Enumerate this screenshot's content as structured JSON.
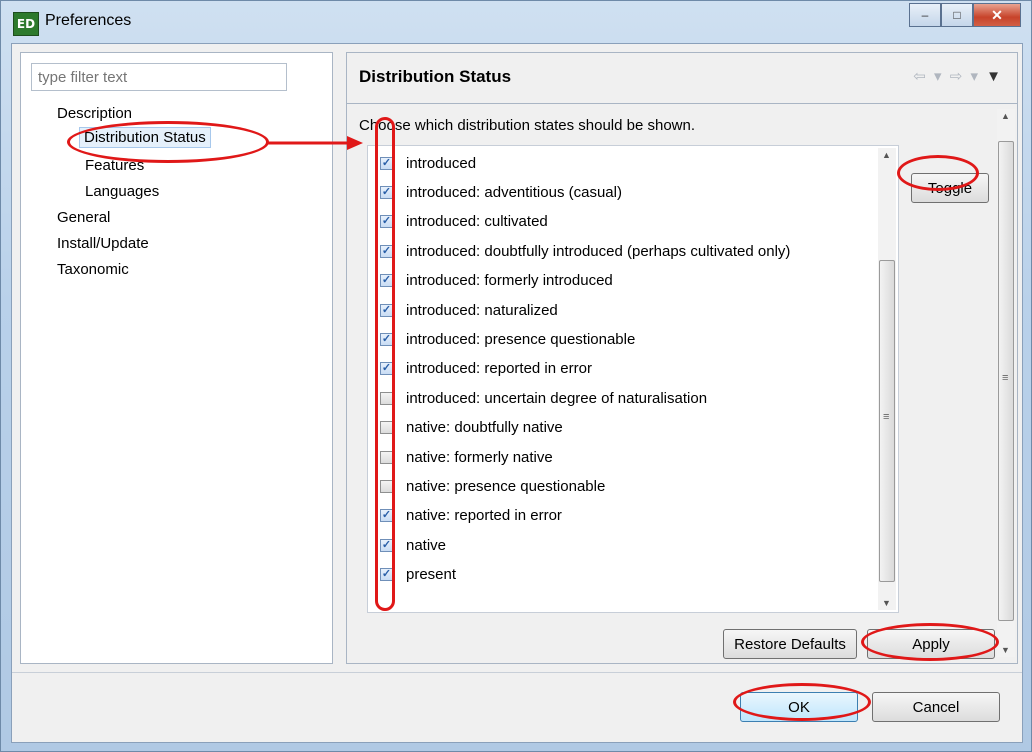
{
  "window": {
    "title": "Preferences",
    "icon_text": "ED",
    "controls": {
      "minimize": "–",
      "maximize": "□",
      "close": "✕"
    }
  },
  "left": {
    "filter_placeholder": "type filter text",
    "tree": [
      {
        "label": "Description",
        "level": 1
      },
      {
        "label": "Distribution Status",
        "level": 2,
        "selected": true
      },
      {
        "label": "Features",
        "level": 2
      },
      {
        "label": "Languages",
        "level": 2
      },
      {
        "label": "General",
        "level": 1
      },
      {
        "label": "Install/Update",
        "level": 1
      },
      {
        "label": "Taxonomic",
        "level": 1
      }
    ]
  },
  "page": {
    "title": "Distribution Status",
    "nav": {
      "back": "⇦",
      "forward": "⇨",
      "dropdown": "▾",
      "menu": "▼"
    },
    "description": "Choose which distribution states should be shown.",
    "toggle_label": "Toggle",
    "items": [
      {
        "label": "introduced",
        "checked": true
      },
      {
        "label": "introduced: adventitious (casual)",
        "checked": true
      },
      {
        "label": "introduced: cultivated",
        "checked": true
      },
      {
        "label": "introduced: doubtfully introduced (perhaps cultivated only)",
        "checked": true
      },
      {
        "label": "introduced: formerly introduced",
        "checked": true
      },
      {
        "label": "introduced: naturalized",
        "checked": true
      },
      {
        "label": "introduced: presence questionable",
        "checked": true
      },
      {
        "label": "introduced: reported in error",
        "checked": true
      },
      {
        "label": "introduced: uncertain degree of naturalisation",
        "checked": false
      },
      {
        "label": "native: doubtfully native",
        "checked": false
      },
      {
        "label": "native: formerly native",
        "checked": false
      },
      {
        "label": "native: presence questionable",
        "checked": false
      },
      {
        "label": "native: reported in error",
        "checked": true
      },
      {
        "label": "native",
        "checked": true
      },
      {
        "label": "present",
        "checked": true
      }
    ],
    "restore_defaults_label": "Restore Defaults",
    "apply_label": "Apply"
  },
  "footer": {
    "ok_label": "OK",
    "cancel_label": "Cancel"
  },
  "colors": {
    "annotation": "#e01818",
    "check": "#2a5fa8"
  }
}
